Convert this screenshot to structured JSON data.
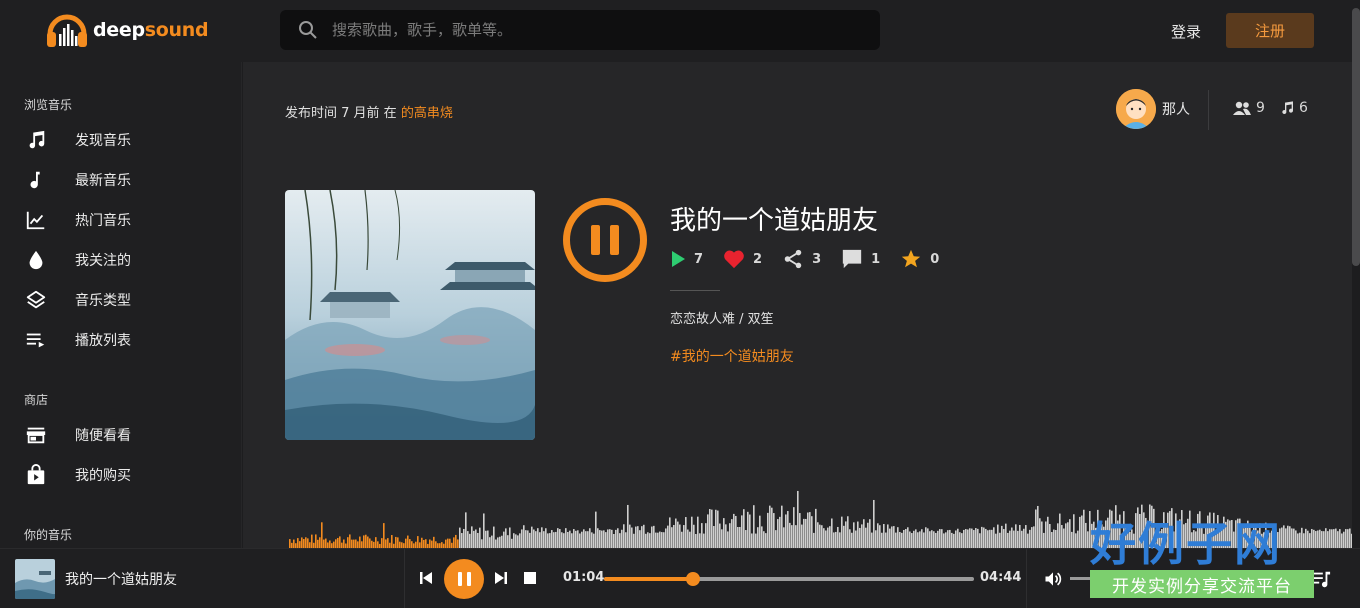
{
  "header": {
    "logo_text_prefix": "deep",
    "logo_text_suffix": "sound",
    "search_placeholder": "搜索歌曲，歌手，歌单等。",
    "login_label": "登录",
    "signup_label": "注册"
  },
  "sidebar": {
    "sections": [
      {
        "heading": "浏览音乐"
      },
      {
        "heading": "商店"
      },
      {
        "heading": "你的音乐"
      }
    ],
    "items": [
      {
        "label": "发现音乐",
        "icon": "music-note-double-icon"
      },
      {
        "label": "最新音乐",
        "icon": "music-note-icon"
      },
      {
        "label": "热门音乐",
        "icon": "trending-chart-icon"
      },
      {
        "label": "我关注的",
        "icon": "drop-icon"
      },
      {
        "label": "音乐类型",
        "icon": "layers-icon"
      },
      {
        "label": "播放列表",
        "icon": "playlist-icon"
      },
      {
        "label": "随便看看",
        "icon": "store-icon"
      },
      {
        "label": "我的购买",
        "icon": "shopping-bag-icon"
      }
    ]
  },
  "track": {
    "published_prefix": "发布时间 7 月前 在",
    "published_link": "的高串烧",
    "uploader_name": "那人",
    "followers_count": "9",
    "tracks_count": "6",
    "title": "我的一个道姑朋友",
    "plays": "7",
    "likes": "2",
    "shares": "3",
    "comments": "1",
    "favorites": "0",
    "artist": "恋恋故人难 / 双笙",
    "tag": "#我的一个道姑朋友"
  },
  "player": {
    "title": "我的一个道姑朋友",
    "current_time": "01:04",
    "duration": "04:44",
    "progress": 0.24,
    "volume": 0.5
  },
  "watermark": {
    "title": "好例子网",
    "subtitle": "开发实例分享交流平台"
  },
  "colors": {
    "accent": "#f38b1f",
    "play_green": "#2ecc71",
    "like_red": "#e8232f",
    "star_yellow": "#f3a51f"
  }
}
